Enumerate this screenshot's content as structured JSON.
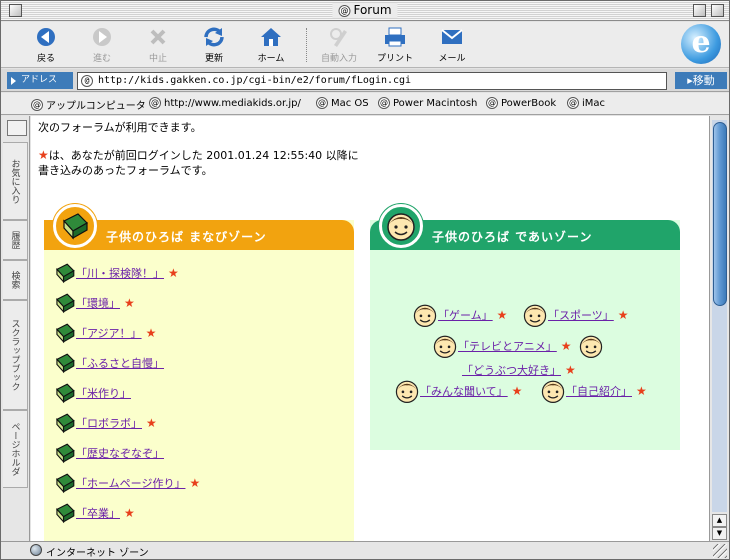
{
  "window": {
    "title": "Forum"
  },
  "toolbar": {
    "buttons": [
      {
        "label": "戻る",
        "icon": "back-arrow-icon",
        "enabled": true
      },
      {
        "label": "進む",
        "icon": "forward-arrow-icon",
        "enabled": false
      },
      {
        "label": "中止",
        "icon": "stop-icon",
        "enabled": false
      },
      {
        "label": "更新",
        "icon": "refresh-icon",
        "enabled": true
      },
      {
        "label": "ホーム",
        "icon": "home-icon",
        "enabled": true
      },
      {
        "label": "自動入力",
        "icon": "autofill-icon",
        "enabled": false
      },
      {
        "label": "プリント",
        "icon": "print-icon",
        "enabled": true
      },
      {
        "label": "メール",
        "icon": "mail-icon",
        "enabled": true
      }
    ]
  },
  "address": {
    "label": "アドレス",
    "url": "http://kids.gakken.co.jp/cgi-bin/e2/forum/fLogin.cgi",
    "go": "移動"
  },
  "favorites": [
    "アップルコンピュータ",
    "http://www.mediakids.or.jp/",
    "Mac OS",
    "Power Macintosh",
    "PowerBook",
    "iMac"
  ],
  "sidebar": {
    "tabs": [
      "お気に入り",
      "履歴",
      "検索",
      "スクラップブック",
      "ページホルダ"
    ]
  },
  "content": {
    "intro": "次のフォーラムが利用できます。",
    "note_line1": "は、あなたが前回ログインした 2001.01.24 12:55:40 以降に",
    "note_line2": "書き込みのあったフォーラムです。",
    "left_panel": {
      "title": "子供のひろば まなびゾーン",
      "items": [
        {
          "label": "「川・探検隊！」",
          "new": true
        },
        {
          "label": "「環境」",
          "new": true
        },
        {
          "label": "「アジア！」",
          "new": true
        },
        {
          "label": "「ふるさと自慢」",
          "new": false
        },
        {
          "label": "「米作り」",
          "new": false
        },
        {
          "label": "「ロボラボ」",
          "new": true
        },
        {
          "label": "「歴史なぞなぞ」",
          "new": false
        },
        {
          "label": "「ホームページ作り」",
          "new": true
        },
        {
          "label": "「卒業」",
          "new": true
        }
      ]
    },
    "right_panel": {
      "title": "子供のひろば であいゾーン",
      "items": [
        {
          "label": "「ゲーム」",
          "new": true
        },
        {
          "label": "「スポーツ」",
          "new": true
        },
        {
          "label": "「テレビとアニメ」",
          "new": true
        },
        {
          "label": "「どうぶつ大好き」",
          "new": true
        },
        {
          "label": "「みんな聞いて」",
          "new": true
        },
        {
          "label": "「自己紹介」",
          "new": true
        }
      ]
    }
  },
  "status": {
    "zone": "インターネット ゾーン"
  },
  "colors": {
    "orange": "#f2a30f",
    "green": "#20a46a",
    "link": "#6b21a8",
    "star": "#e8401c",
    "accent_blue": "#3d7bb9"
  }
}
